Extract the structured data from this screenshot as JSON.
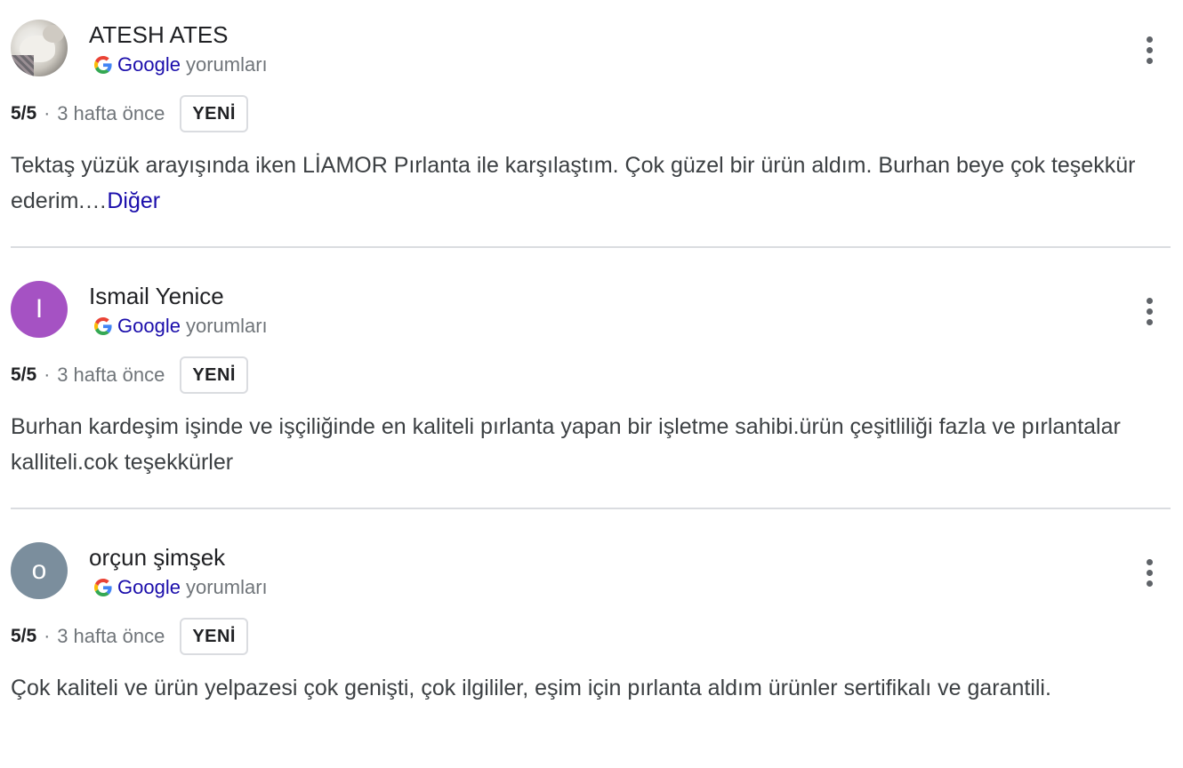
{
  "reviews": [
    {
      "author": "ATESH ATES",
      "avatar": {
        "type": "photo",
        "letter": ""
      },
      "source_brand": "Google",
      "source_suffix": "yorumları",
      "rating": "5/5",
      "separator": "·",
      "time": "3 hafta önce",
      "badge": "YENİ",
      "text": "Tektaş yüzük arayışında iken LİAMOR Pırlanta ile karşılaştım. Çok güzel bir ürün aldım. Burhan beye çok teşekkür ederim.…",
      "more_label": "Diğer"
    },
    {
      "author": "Ismail Yenice",
      "avatar": {
        "type": "letter",
        "letter": "I",
        "color": "#a552c3"
      },
      "source_brand": "Google",
      "source_suffix": "yorumları",
      "rating": "5/5",
      "separator": "·",
      "time": "3 hafta önce",
      "badge": "YENİ",
      "text": "Burhan kardeşim işinde ve işçiliğinde en kaliteli pırlanta yapan bir işletme sahibi.ürün çeşitliliği fazla ve pırlantalar kalliteli.cok teşekkürler",
      "more_label": ""
    },
    {
      "author": "orçun şimşek",
      "avatar": {
        "type": "letter",
        "letter": "o",
        "color": "#7b8e9d"
      },
      "source_brand": "Google",
      "source_suffix": "yorumları",
      "rating": "5/5",
      "separator": "·",
      "time": "3 hafta önce",
      "badge": "YENİ",
      "text": "Çok kaliteli ve ürün yelpazesi çok genişti, çok ilgililer, eşim için pırlanta aldım ürünler sertifikalı ve garantili.",
      "more_label": ""
    }
  ],
  "icons": {
    "google": "google-g-icon",
    "more": "more-vert-icon"
  },
  "colors": {
    "link": "#1a0dab",
    "muted": "#70757a",
    "divider": "#dadce0"
  }
}
